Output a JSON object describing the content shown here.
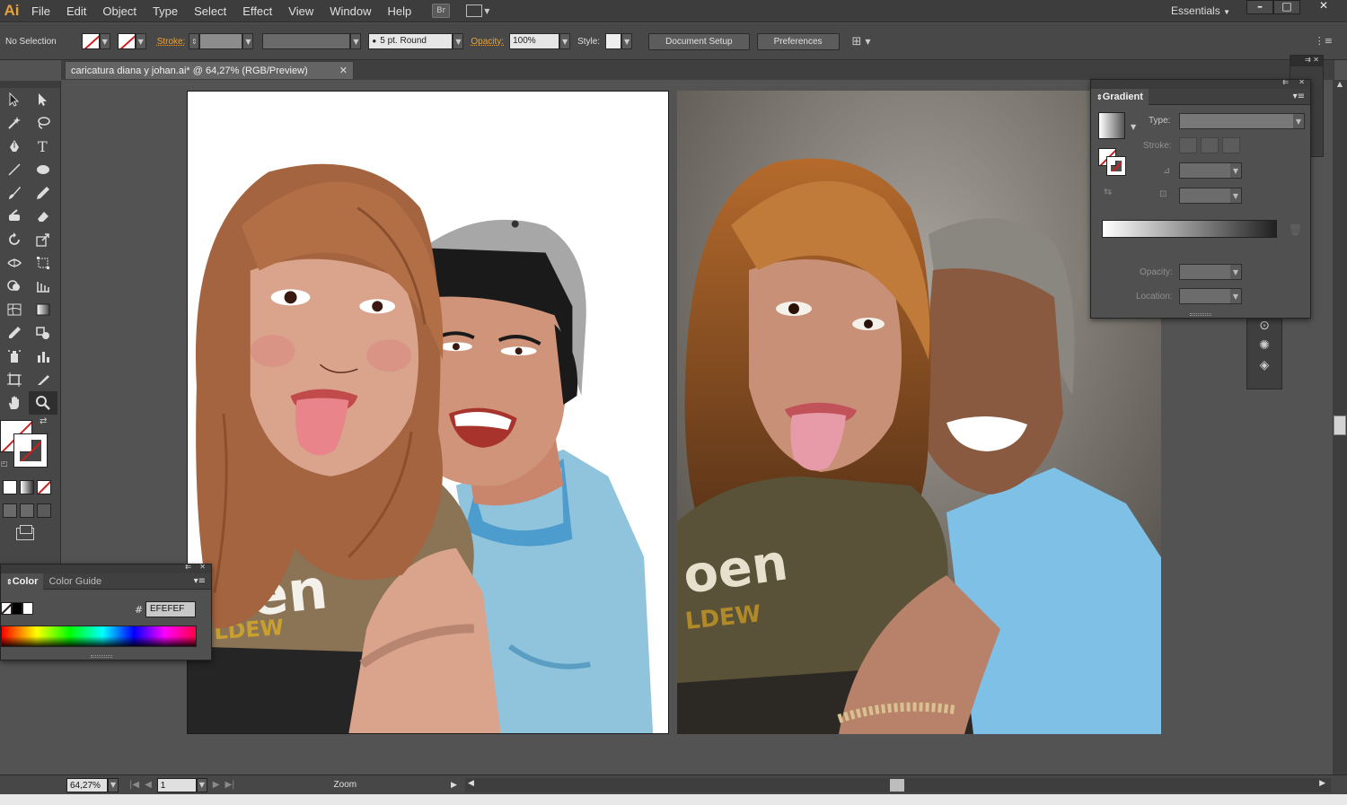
{
  "app": {
    "logo": "Ai"
  },
  "menu": {
    "items": [
      "File",
      "Edit",
      "Object",
      "Type",
      "Select",
      "Effect",
      "View",
      "Window",
      "Help"
    ],
    "bridge_label": "Br",
    "workspace": "Essentials"
  },
  "window_controls": {
    "minimize": "–",
    "maximize": "□",
    "close": "✕"
  },
  "control_bar": {
    "selection_status": "No Selection",
    "stroke_label": "Stroke:",
    "brush_value": "5 pt. Round",
    "opacity_label": "Opacity:",
    "opacity_value": "100%",
    "style_label": "Style:",
    "document_setup": "Document Setup",
    "preferences": "Preferences"
  },
  "document": {
    "tab_title": "caricatura diana y johan.ai* @ 64,27% (RGB/Preview)",
    "tab_close": "✕"
  },
  "status_bar": {
    "zoom": "64,27%",
    "page": "1",
    "status_text": "Zoom"
  },
  "gradient_panel": {
    "title": "Gradient",
    "type_label": "Type:",
    "stroke_label": "Stroke:",
    "opacity_label": "Opacity:",
    "location_label": "Location:",
    "gradient_start": "#ffffff",
    "gradient_end": "#202020"
  },
  "color_panel": {
    "tabs": [
      "Color",
      "Color Guide"
    ],
    "hex_label": "#",
    "hex_value": "EFEFEF"
  },
  "artwork": {
    "hair_color": "#a4643f",
    "skin_girl": "#d9a38c",
    "skin_boy": "#cf9479",
    "shirt_girl": "#8b7355",
    "shirt_boy": "#90c3dc",
    "cap_color": "#a7a7a7",
    "shirt_print_text": "oen",
    "shirt_print_sub": "LDEW"
  },
  "photo": {
    "shirt_print_text": "oen",
    "shirt_print_sub": "LDEW"
  }
}
